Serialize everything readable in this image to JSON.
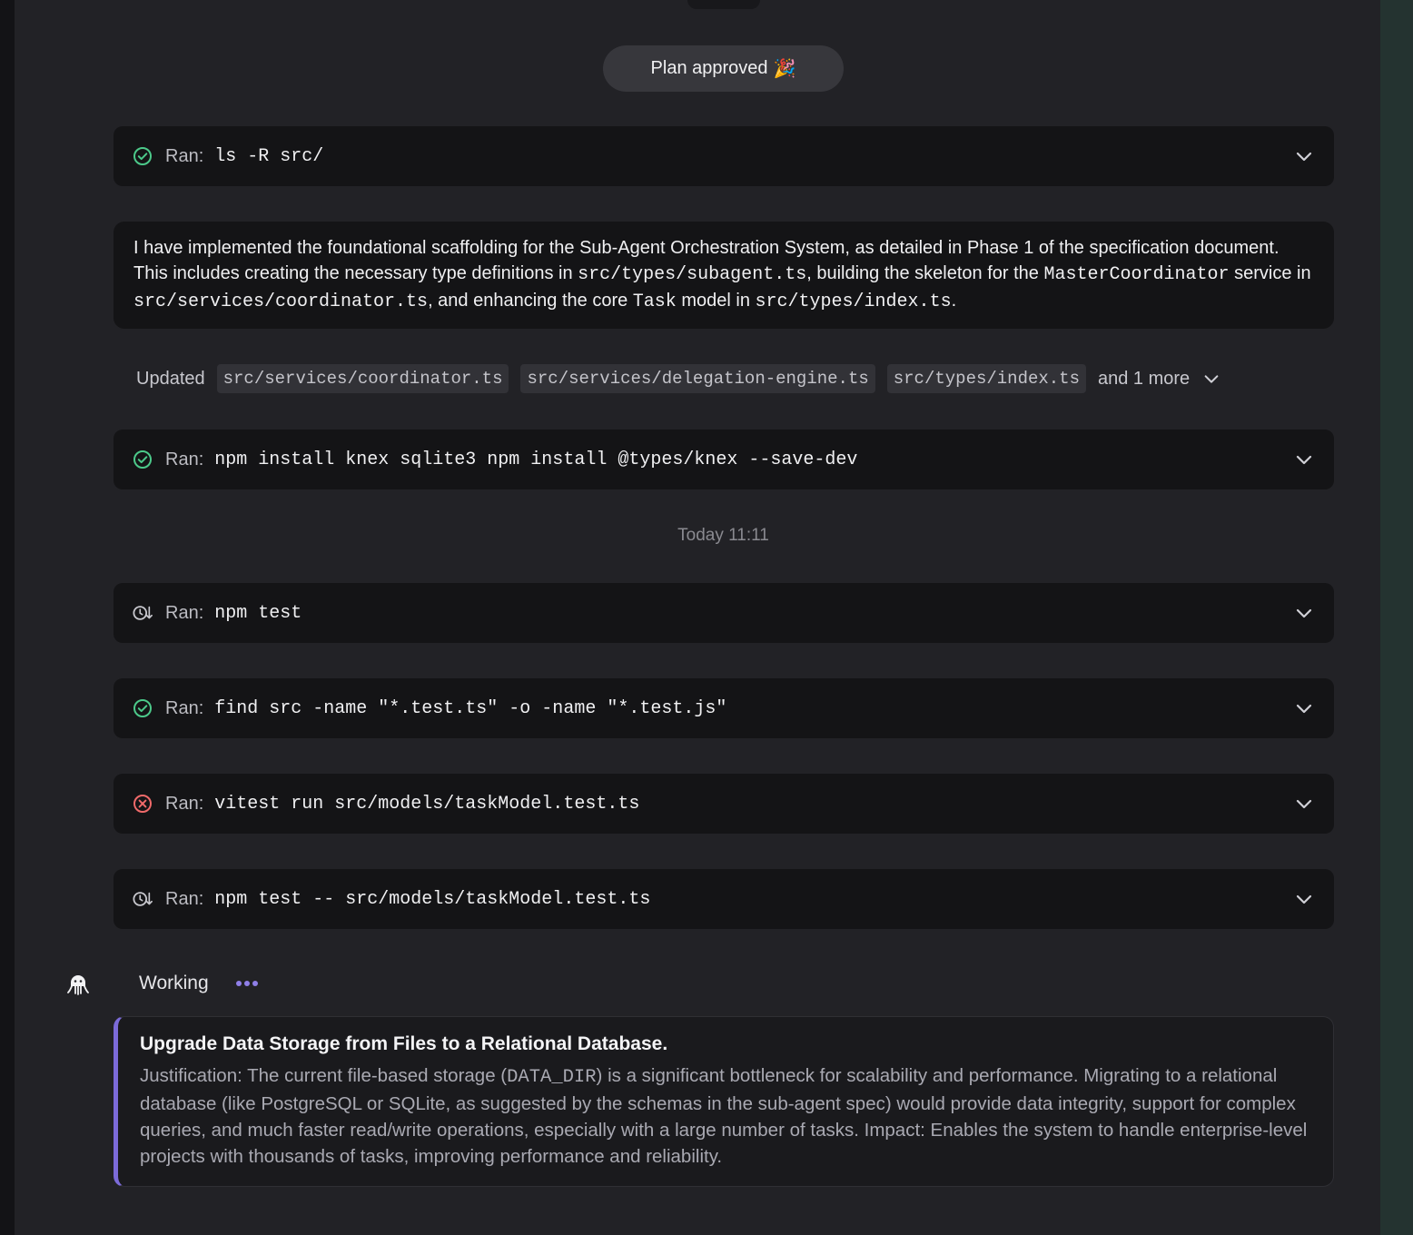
{
  "banner": {
    "text": "Plan approved",
    "emoji": "🎉"
  },
  "runs": [
    {
      "label": "Ran:",
      "command": "ls -R src/",
      "status": "success"
    },
    {
      "label": "Ran:",
      "command": "npm install knex sqlite3 npm install @types/knex --save-dev",
      "status": "success"
    },
    {
      "label": "Ran:",
      "command": "npm test",
      "status": "pending"
    },
    {
      "label": "Ran:",
      "command": "find src -name \"*.test.ts\" -o -name \"*.test.js\"",
      "status": "success"
    },
    {
      "label": "Ran:",
      "command": "vitest run src/models/taskModel.test.ts",
      "status": "error"
    },
    {
      "label": "Ran:",
      "command": "npm test -- src/models/taskModel.test.ts",
      "status": "pending"
    }
  ],
  "summary": {
    "t1": "I have implemented the foundational scaffolding for the Sub-Agent Orchestration System, as detailed in Phase 1 of the specification document. This includes creating the necessary type definitions in ",
    "c1": "src/types/subagent.ts",
    "t2": ", building the skeleton for the ",
    "c2": "MasterCoordinator",
    "t3": " service in ",
    "c3": "src/services/coordinator.ts",
    "t4": ", and enhancing the core ",
    "c4": "Task",
    "t5": " model in ",
    "c5": "src/types/index.ts",
    "t6": "."
  },
  "updated": {
    "label": "Updated",
    "files": [
      "src/services/coordinator.ts",
      "src/services/delegation-engine.ts",
      "src/types/index.ts"
    ],
    "more": "and 1 more"
  },
  "timestamp": "Today 11:11",
  "working": {
    "text": "Working"
  },
  "proposal": {
    "title": "Upgrade Data Storage from Files to a Relational Database.",
    "b1": "Justification: The current file-based storage (",
    "code": "DATA_DIR",
    "b2": ") is a significant bottleneck for scalability and performance. Migrating to a relational database (like PostgreSQL or SQLite, as suggested by the schemas in the sub-agent spec) would provide data integrity, support for complex queries, and much faster read/write operations, especially with a large number of tasks. Impact: Enables the system to handle enterprise-level projects with thousands of tasks, improving performance and reliability."
  },
  "colors": {
    "success": "#4cc98a",
    "error": "#f06a6a",
    "pending": "#c8c8ce",
    "accent": "#7c6bd9"
  },
  "icons": {
    "success": "check-circle-icon",
    "error": "x-circle-icon",
    "pending": "clock-arrow-icon",
    "expand": "chevron-down-icon",
    "agent": "octopus-agent-icon"
  }
}
